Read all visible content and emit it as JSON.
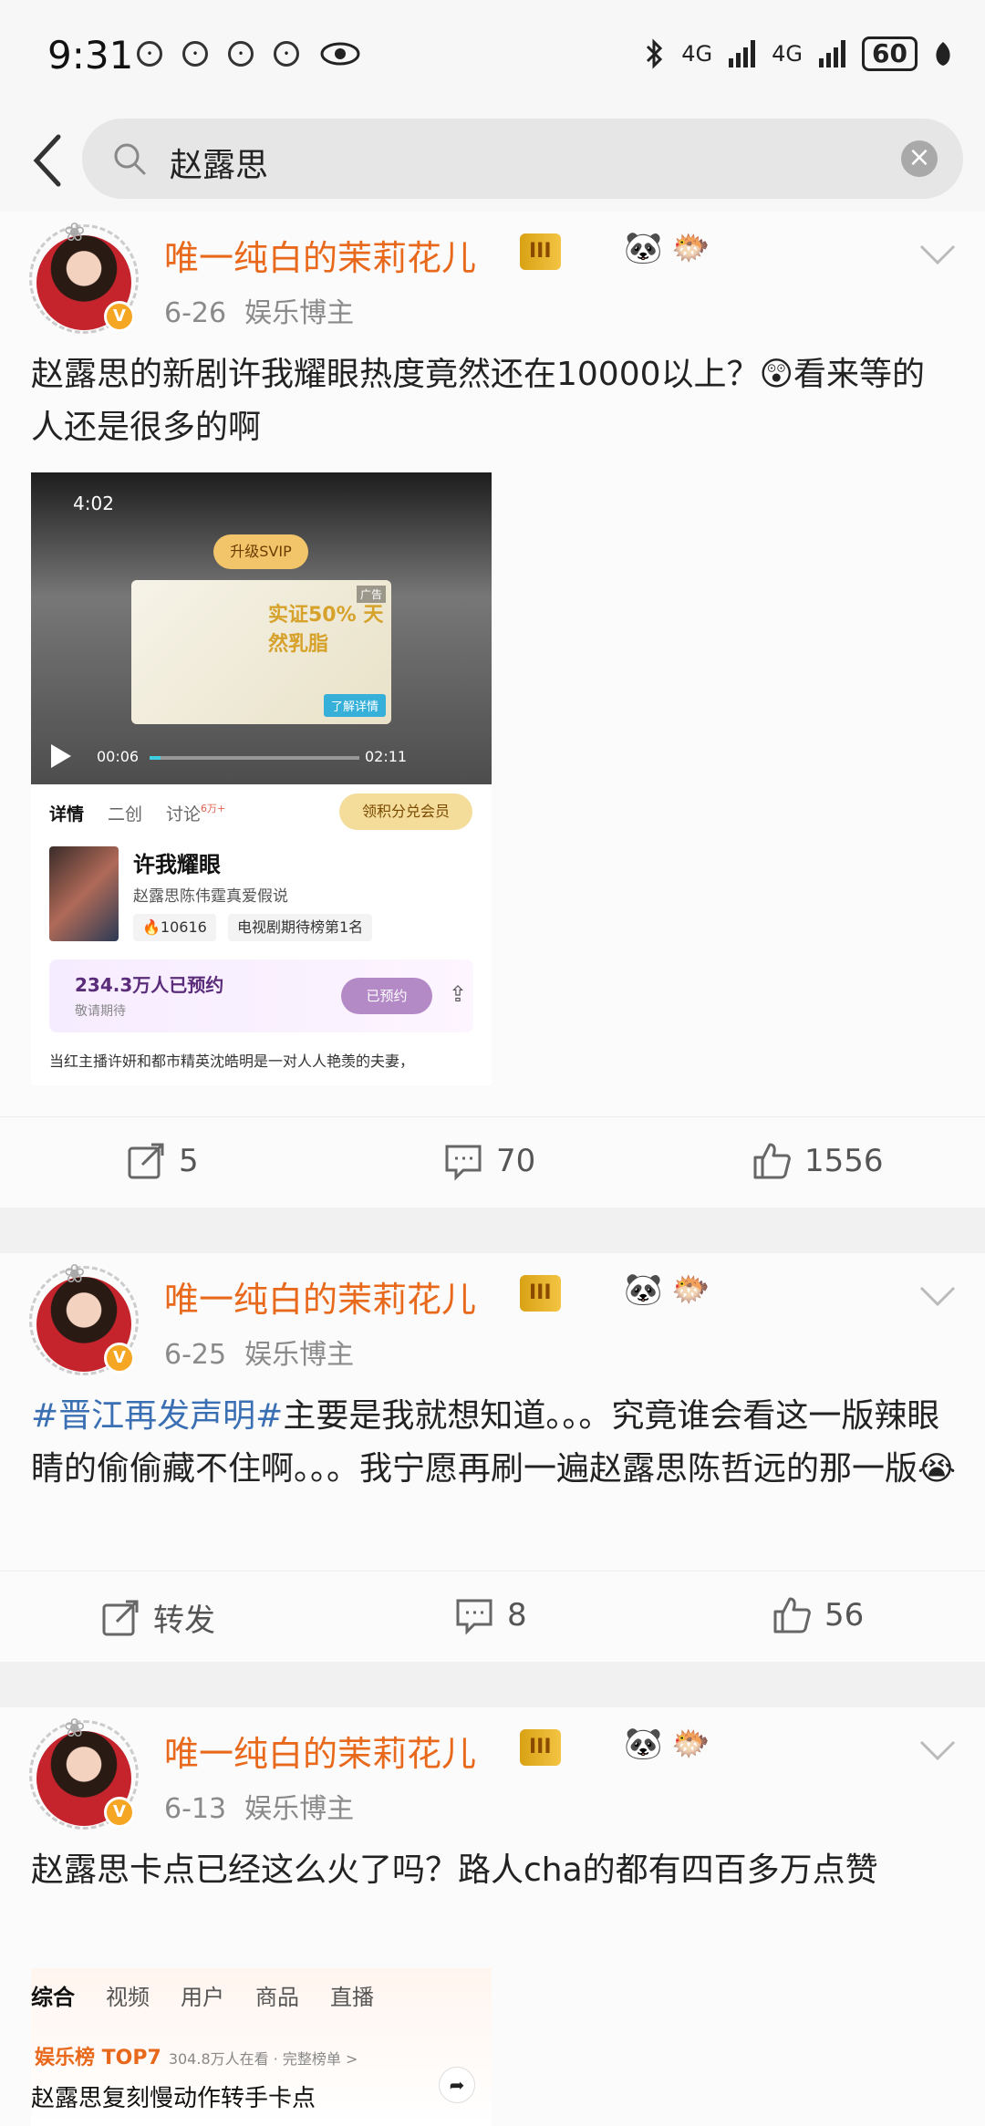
{
  "status_bar": {
    "time": "9:31",
    "network1": "4G",
    "network2": "4G",
    "battery": "60"
  },
  "search": {
    "query": "赵露思"
  },
  "posts": [
    {
      "user": "唯一纯白的茉莉花儿",
      "level": "III",
      "date": "6-26",
      "role": "娱乐博主",
      "text": "赵露思的新剧许我耀眼热度竟然还在10000以上？😲看来等的人还是很多的啊",
      "repost": "5",
      "comments": "70",
      "likes": "1556",
      "embed": {
        "time": "4:02",
        "svip": "升级SVIP",
        "ad_title": "实证50% 天然乳脂",
        "ad_tag": "广告",
        "ad_button": "了解详情",
        "current_time": "00:06",
        "duration": "02:11",
        "progress": 0.05,
        "tabs": [
          "详情",
          "二创",
          "讨论"
        ],
        "discuss_count": "6万+",
        "member_button": "领积分兑会员",
        "drama_title": "许我耀眼",
        "drama_cast": "赵露思陈伟霆真爱假说",
        "heat": "10616",
        "rank": "电视剧期待榜第1名",
        "reserve_count": "234.3万人已预约",
        "reserve_sub": "敬请期待",
        "reserve_button": "已预约",
        "description": "当红主播许妍和都市精英沈皓明是一对人人艳羡的夫妻，"
      }
    },
    {
      "user": "唯一纯白的茉莉花儿",
      "level": "III",
      "date": "6-25",
      "role": "娱乐博主",
      "hashtag": "#晋江再发声明#",
      "text": "主要是我就想知道。。。究竟谁会看这一版辣眼睛的偷偷藏不住啊。。。我宁愿再刷一遍赵露思陈哲远的那一版😭",
      "repost": "转发",
      "comments": "8",
      "likes": "56"
    },
    {
      "user": "唯一纯白的茉莉花儿",
      "level": "III",
      "date": "6-13",
      "role": "娱乐博主",
      "text": "赵露思卡点已经这么火了吗？路人cha的都有四百多万点赞",
      "embed": {
        "tabs": [
          "综合",
          "视频",
          "用户",
          "商品",
          "直播"
        ],
        "rank_label": "娱乐榜 TOP7",
        "rank_meta": "304.8万人在看 · 完整榜单 >",
        "title": "赵露思复刻慢动作转手卡点"
      }
    }
  ],
  "colors": {
    "username": "#e8691c",
    "hashtag": "#3b6fb3",
    "meta": "#8a8a8a"
  }
}
